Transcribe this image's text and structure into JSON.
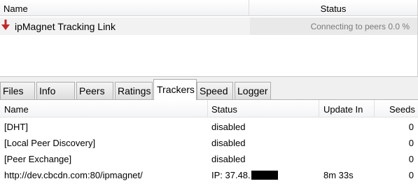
{
  "torrent_list": {
    "columns": {
      "name": "Name",
      "status": "Status"
    },
    "rows": [
      {
        "name": "ipMagnet Tracking Link",
        "status": "Connecting to peers 0.0 %",
        "icon": "down-arrow-icon",
        "icon_color": "#c0282c"
      }
    ]
  },
  "tabs": [
    {
      "label": "Files",
      "active": false
    },
    {
      "label": "Info",
      "active": false
    },
    {
      "label": "Peers",
      "active": false
    },
    {
      "label": "Ratings",
      "active": false
    },
    {
      "label": "Trackers",
      "active": true
    },
    {
      "label": "Speed",
      "active": false
    },
    {
      "label": "Logger",
      "active": false
    }
  ],
  "trackers": {
    "columns": {
      "name": "Name",
      "status": "Status",
      "update_in": "Update In",
      "seeds": "Seeds"
    },
    "rows": [
      {
        "name": "[DHT]",
        "status": "disabled",
        "update_in": "",
        "seeds": "0"
      },
      {
        "name": "[Local Peer Discovery]",
        "status": "disabled",
        "update_in": "",
        "seeds": "0"
      },
      {
        "name": "[Peer Exchange]",
        "status": "disabled",
        "update_in": "",
        "seeds": "0"
      },
      {
        "name": "http://dev.cbcdn.com:80/ipmagnet/",
        "status": "IP: 37.48.",
        "update_in": "8m 33s",
        "seeds": "0"
      }
    ]
  }
}
